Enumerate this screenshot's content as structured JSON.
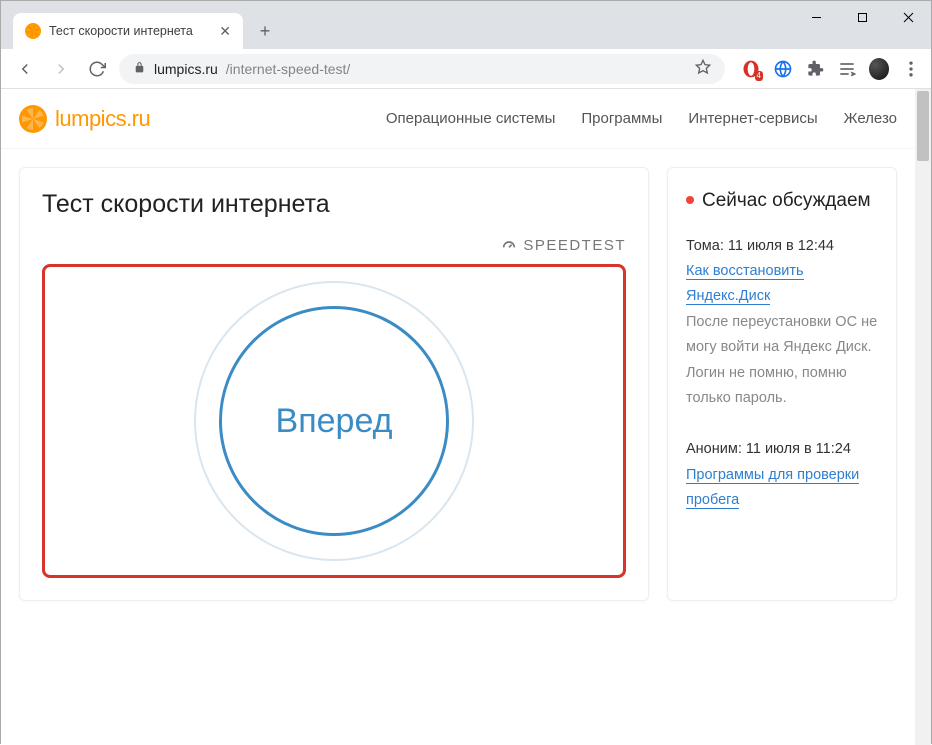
{
  "browser": {
    "tab_title": "Тест скорости интернета",
    "url_host": "lumpics.ru",
    "url_path": "/internet-speed-test/",
    "ext_badge": "4"
  },
  "site": {
    "logo": "lumpics.ru",
    "nav": [
      "Операционные системы",
      "Программы",
      "Интернет-сервисы",
      "Железо"
    ]
  },
  "main": {
    "title": "Тест скорости интернета",
    "brand": "SPEEDTEST",
    "go_label": "Вперед"
  },
  "sidebar": {
    "title": "Сейчас обсуждаем",
    "comments": [
      {
        "meta": "Тома: 11 июля в 12:44",
        "link": "Как восстановить Яндекс.Диск",
        "text": "После переустановки ОС не могу войти на Яндекс Диск. Логин не помню, помню только пароль."
      },
      {
        "meta": "Аноним: 11 июля в 11:24",
        "link": "Программы для проверки пробега"
      }
    ]
  }
}
